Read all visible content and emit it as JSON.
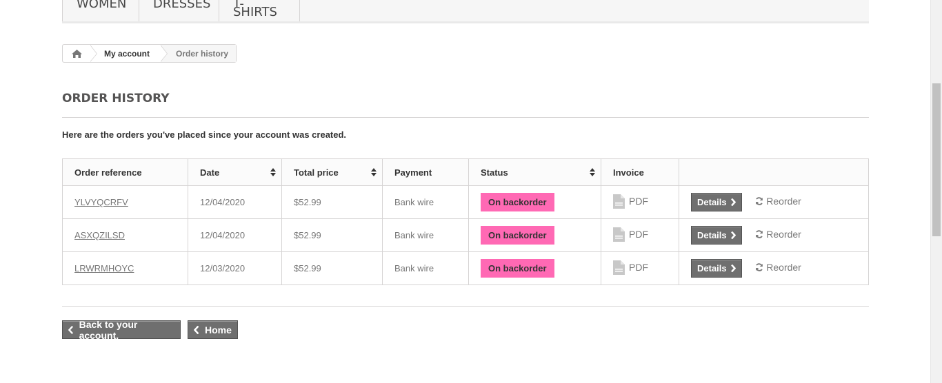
{
  "top_nav": {
    "items": [
      "WOMEN",
      "DRESSES",
      "T-SHIRTS"
    ]
  },
  "breadcrumb": {
    "home_icon": "home-icon",
    "link": "My account",
    "current": "Order history"
  },
  "page": {
    "heading": "ORDER HISTORY",
    "intro": "Here are the orders you've placed since your account was created."
  },
  "table": {
    "headers": [
      "Order reference",
      "Date",
      "Total price",
      "Payment",
      "Status",
      "Invoice",
      ""
    ],
    "rows": [
      {
        "reference": "YLVYQCRFV",
        "date": "12/04/2020",
        "total": "$52.99",
        "payment": "Bank wire",
        "status": "On backorder",
        "invoice": "PDF",
        "details": "Details",
        "reorder": "Reorder"
      },
      {
        "reference": "ASXQZILSD",
        "date": "12/04/2020",
        "total": "$52.99",
        "payment": "Bank wire",
        "status": "On backorder",
        "invoice": "PDF",
        "details": "Details",
        "reorder": "Reorder"
      },
      {
        "reference": "LRWRMHOYC",
        "date": "12/03/2020",
        "total": "$52.99",
        "payment": "Bank wire",
        "status": "On backorder",
        "invoice": "PDF",
        "details": "Details",
        "reorder": "Reorder"
      }
    ]
  },
  "footer": {
    "back_label": "Back to your account.",
    "home_label": "Home"
  },
  "colors": {
    "status_badge": "#ff69b4",
    "button": "#6f6f6f"
  }
}
